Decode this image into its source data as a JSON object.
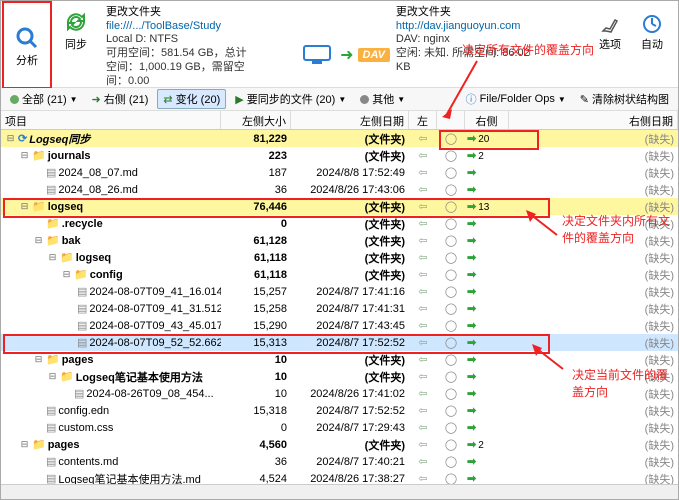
{
  "top": {
    "analyze": "分析",
    "sync": "同步",
    "options": "选项",
    "auto": "自动"
  },
  "leftInfo": {
    "chg": "更改文件夹",
    "path": "file:///.../ToolBase/Study",
    "disk": "Local D: NTFS",
    "l1": "可用空间：581.54 GB，总计",
    "l2": "空间：1,000.19 GB，需留空",
    "l3": "间：0.00"
  },
  "rightInfo": {
    "chg": "更改文件夹",
    "path": "http://dav.jianguoyun.com",
    "dav": "DAV",
    "davserver": "DAV: nginx",
    "l1": "空闲: 未知. 所需空间: 86.02",
    "l2": "KB"
  },
  "ann": {
    "top": "决定所有文件的覆盖方向",
    "mid": "决定文件夹内所有文件的覆盖方向",
    "bot": "决定当前文件的覆盖方向"
  },
  "filter": {
    "all": "全部 (21)",
    "right": "右侧 (21)",
    "changes": "变化 (20)",
    "tosync": "要同步的文件 (20)",
    "other": "其他",
    "ops": "File/Folder Ops",
    "clear": "清除树状结构图"
  },
  "headers": {
    "name": "项目",
    "lsize": "左侧大小",
    "ldate": "左侧日期",
    "left": "左侧",
    "right": "右侧",
    "rdate": "右侧日期"
  },
  "missing": "(缺失)",
  "folderLabel": "(文件夹)",
  "rows": [
    {
      "d": 0,
      "exp": "-",
      "type": "root",
      "name": "Logseq同步",
      "bold": true,
      "italic": true,
      "size": "81,229",
      "date": "(文件夹)",
      "right": "20",
      "hl": "yellow"
    },
    {
      "d": 1,
      "exp": "-",
      "type": "folder",
      "name": "journals",
      "bold": true,
      "size": "223",
      "date": "(文件夹)",
      "right": "2"
    },
    {
      "d": 2,
      "exp": "",
      "type": "file",
      "name": "2024_08_07.md",
      "size": "187",
      "date": "2024/8/8 17:52:49"
    },
    {
      "d": 2,
      "exp": "",
      "type": "file",
      "name": "2024_08_26.md",
      "size": "36",
      "date": "2024/8/26 17:43:06"
    },
    {
      "d": 1,
      "exp": "-",
      "type": "folder",
      "name": "logseq",
      "bold": true,
      "size": "76,446",
      "date": "(文件夹)",
      "right": "13",
      "hl": "yellow2",
      "redbox": true
    },
    {
      "d": 2,
      "exp": "",
      "type": "folder",
      "name": ".recycle",
      "bold": true,
      "size": "0",
      "date": "(文件夹)"
    },
    {
      "d": 2,
      "exp": "-",
      "type": "folder",
      "name": "bak",
      "bold": true,
      "size": "61,128",
      "date": "(文件夹)"
    },
    {
      "d": 3,
      "exp": "-",
      "type": "folder",
      "name": "logseq",
      "bold": true,
      "size": "61,118",
      "date": "(文件夹)"
    },
    {
      "d": 4,
      "exp": "-",
      "type": "folder",
      "name": "config",
      "bold": true,
      "size": "61,118",
      "date": "(文件夹)"
    },
    {
      "d": 5,
      "exp": "",
      "type": "file",
      "name": "2024-08-07T09_41_16.014...",
      "size": "15,257",
      "date": "2024/8/7 17:41:16"
    },
    {
      "d": 5,
      "exp": "",
      "type": "file",
      "name": "2024-08-07T09_41_31.512...",
      "size": "15,258",
      "date": "2024/8/7 17:41:31"
    },
    {
      "d": 5,
      "exp": "",
      "type": "file",
      "name": "2024-08-07T09_43_45.017...",
      "size": "15,290",
      "date": "2024/8/7 17:43:45"
    },
    {
      "d": 5,
      "exp": "",
      "type": "file",
      "name": "2024-08-07T09_52_52.662...",
      "size": "15,313",
      "date": "2024/8/7 17:52:52",
      "hl": "blue",
      "redbox": true
    },
    {
      "d": 2,
      "exp": "-",
      "type": "folder",
      "name": "pages",
      "bold": true,
      "size": "10",
      "date": "(文件夹)"
    },
    {
      "d": 3,
      "exp": "-",
      "type": "folder",
      "name": "Logseq笔记基本使用方法",
      "bold": true,
      "size": "10",
      "date": "(文件夹)"
    },
    {
      "d": 4,
      "exp": "",
      "type": "file",
      "name": "2024-08-26T09_08_454...",
      "size": "10",
      "date": "2024/8/26 17:41:02"
    },
    {
      "d": 2,
      "exp": "",
      "type": "file",
      "name": "config.edn",
      "size": "15,318",
      "date": "2024/8/7 17:52:52"
    },
    {
      "d": 2,
      "exp": "",
      "type": "file",
      "name": "custom.css",
      "size": "0",
      "date": "2024/8/7 17:29:43"
    },
    {
      "d": 1,
      "exp": "-",
      "type": "folder",
      "name": "pages",
      "bold": true,
      "size": "4,560",
      "date": "(文件夹)",
      "right": "2"
    },
    {
      "d": 2,
      "exp": "",
      "type": "file",
      "name": "contents.md",
      "size": "36",
      "date": "2024/8/7 17:40:21"
    },
    {
      "d": 2,
      "exp": "",
      "type": "file",
      "name": "Logseq笔记基本使用方法.md",
      "size": "4,524",
      "date": "2024/8/26 17:38:27"
    }
  ]
}
